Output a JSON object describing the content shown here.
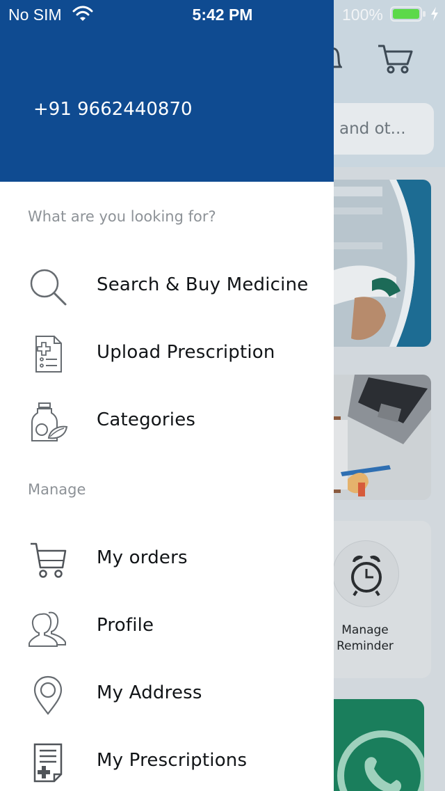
{
  "status_bar": {
    "carrier": "No SIM",
    "time": "5:42 PM",
    "battery": "100%"
  },
  "drawer": {
    "phone": "+91 9662440870",
    "sections": [
      {
        "title": "What are you looking for?",
        "items": [
          {
            "label": "Search & Buy Medicine",
            "icon": "search-icon"
          },
          {
            "label": "Upload Prescription",
            "icon": "prescription-upload-icon"
          },
          {
            "label": "Categories",
            "icon": "categories-icon"
          }
        ]
      },
      {
        "title": "Manage",
        "items": [
          {
            "label": "My orders",
            "icon": "cart-icon"
          },
          {
            "label": "Profile",
            "icon": "profile-icon"
          },
          {
            "label": "My Address",
            "icon": "location-pin-icon"
          },
          {
            "label": "My Prescriptions",
            "icon": "prescriptions-icon"
          }
        ]
      }
    ]
  },
  "background": {
    "search_placeholder": "and ot...",
    "reminder_label": "Manage\nReminder"
  },
  "colors": {
    "drawer_header": "#0f4b91",
    "status_text": "#ffffff",
    "battery_fill": "#5cd94a",
    "label_text": "#111417",
    "section_title": "#8d9297"
  }
}
